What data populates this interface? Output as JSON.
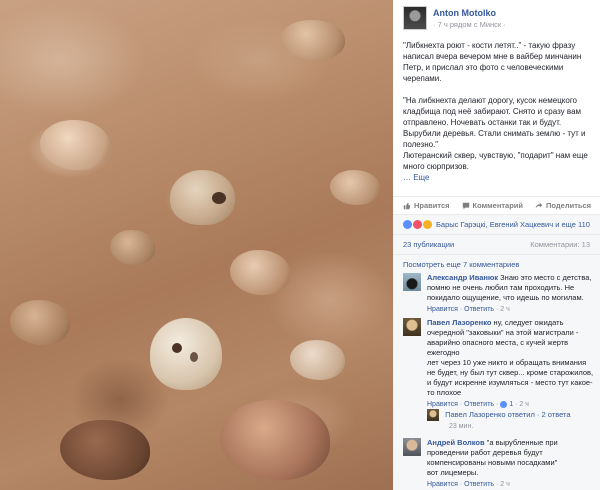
{
  "post": {
    "author": "Anton Motolko",
    "meta": "· 7 ч рядом с Минск ·",
    "paragraphs": [
      "\"Либкнехта роют - кости летят..\" - такую фразу написал вчера вечером мне в вайбер минчанин Петр, и прислал это фото с человеческими черепами.",
      "\"На либкнехта делают дорогу, кусок немецкого кладбища под неё забирают. Снято и сразу вам отправлено. Ночевать останки так и будут. Вырубили деревья. Стали снимать землю - тут и полезно.\"",
      "Лютеранский сквер, чувствую, \"подарит\" нам еще много сюрпризов."
    ],
    "more_label": "… Еще"
  },
  "actions": {
    "like": "Нравится",
    "comment": "Комментарий",
    "share": "Поделиться"
  },
  "reactions": {
    "names": "Барыс Гарэцкі, Евгений Хацкевич и еще 110",
    "colors": {
      "like": "#5890ff",
      "love": "#f25268",
      "wow": "#f7b125"
    }
  },
  "counts": {
    "shares": "23 публикации",
    "comments": "Комментарии: 13"
  },
  "comments": {
    "view_previous": "Посмотреть еще 7 комментариев",
    "items": [
      {
        "name": "Александр Иванюк",
        "text": "Знаю это место с детства, помню не очень любил там проходить. Не покидало ощущение, что идешь по могилам.",
        "like_label": "Нравится",
        "reply_label": "Ответить",
        "time": "2 ч"
      },
      {
        "name": "Павел Лазоренко",
        "text": "ну, следует ожидать очередной \"заковыки\" на этой магистрали - аварийно опасного места, с кучей жертв ежегодно\nлет через 10 уже никто и обращать внимания не будет, ну был тут сквер... кроме старожилов, и будут искренне изумляться - место тут какое-то плохое",
        "like_label": "Нравится",
        "reply_label": "Ответить",
        "likes": "1",
        "time": "2 ч",
        "reply_summary": "Павел Лазоренко ответил · 2 ответа",
        "reply_time": "23 мин."
      },
      {
        "name": "Андрей Волков",
        "text": "\"а вырубленные при проведении работ деревья будут компенсированы новыми посадками\"\nвот лицемеры.",
        "like_label": "Нравится",
        "reply_label": "Ответить",
        "time": "2 ч"
      }
    ]
  }
}
